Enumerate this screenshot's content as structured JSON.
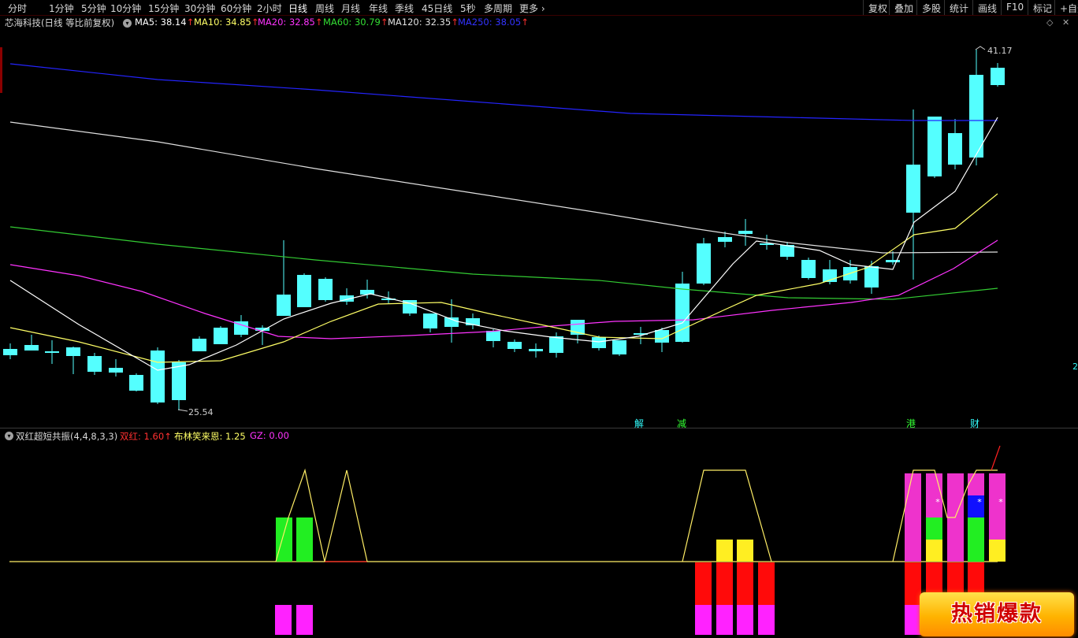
{
  "toolbar": {
    "periods": [
      "分时",
      "1分钟",
      "5分钟",
      "10分钟",
      "15分钟",
      "30分钟",
      "60分钟",
      "2小时",
      "日线",
      "周线",
      "月线",
      "年线",
      "季线",
      "45日线",
      "5秒",
      "多周期",
      "更多"
    ],
    "active_period": "日线",
    "right_buttons": [
      "复权",
      "叠加",
      "多股",
      "统计",
      "画线",
      "F10",
      "标记",
      "+自选"
    ]
  },
  "main_chart": {
    "title": "芯海科技(日线 等比前复权)",
    "ma": [
      {
        "label": "MA5: 38.14",
        "color": "#ffffff"
      },
      {
        "label": "MA10: 34.85",
        "color": "#ffff66"
      },
      {
        "label": "MA20: 32.85",
        "color": "#ff33ff"
      },
      {
        "label": "MA60: 30.79",
        "color": "#33dd33"
      },
      {
        "label": "MA120: 32.35",
        "color": "#e0e0e0"
      },
      {
        "label": "MA250: 38.05",
        "color": "#3333ff"
      }
    ],
    "high_label": "41.17",
    "low_label": "25.54",
    "right_edge_label": "2",
    "signals": [
      {
        "text": "解",
        "color": "#33ffff"
      },
      {
        "text": "减",
        "color": "#33ff33"
      },
      {
        "text": "港",
        "color": "#33ff33"
      },
      {
        "text": "财",
        "color": "#33ffff"
      }
    ]
  },
  "indicator": {
    "title": "双红超短共振(4,4,8,3,3)",
    "values": [
      {
        "label": "双红: 1.60",
        "color": "#ff3030"
      },
      {
        "label": "布林笑来恩: 1.25",
        "color": "#ffff66"
      },
      {
        "label": "GZ: 0.00",
        "color": "#ff33ff"
      }
    ]
  },
  "badge": {
    "text": "热销爆款"
  },
  "colors": {
    "up": "#ff3232",
    "down": "#54ffff",
    "ma5": "#ffffff",
    "ma10": "#ffff66",
    "ma20": "#ff33ff",
    "ma60": "#33cc33",
    "ma120": "#e0e0e0",
    "ma250": "#2424ff"
  }
}
